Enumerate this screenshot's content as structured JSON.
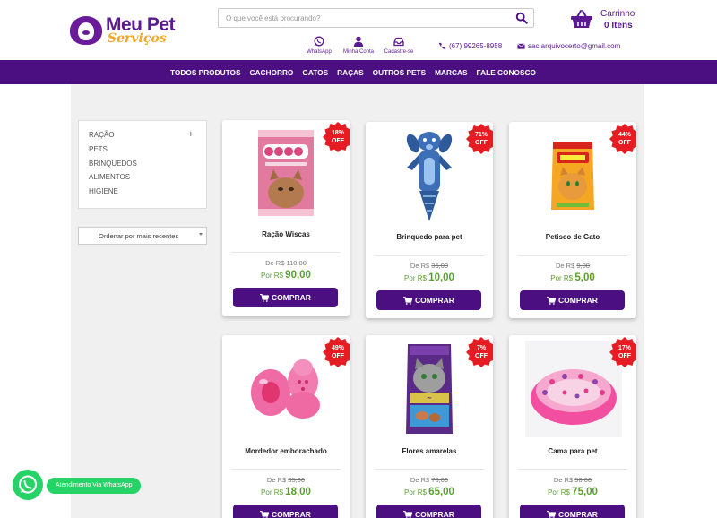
{
  "brand": {
    "name": "Meu Pet",
    "tagline": "Serviços"
  },
  "search": {
    "placeholder": "O que você está procurando?"
  },
  "cart": {
    "label": "Carrinho",
    "count": "0 Itens"
  },
  "quick_links": [
    {
      "label": "WhatsApp",
      "icon": "whatsapp-icon"
    },
    {
      "label": "Minha Conta",
      "icon": "user-icon"
    },
    {
      "label": "Cadastre-se",
      "icon": "signup-icon"
    }
  ],
  "contact": {
    "phone": "(67) 99265-8958",
    "email": "sac.arquivocerto@gmail.com"
  },
  "nav": [
    "TODOS PRODUTOS",
    "CACHORRO",
    "GATOS",
    "RAÇAS",
    "OUTROS PETS",
    "MARCAS",
    "FALE CONOSCO"
  ],
  "filters": {
    "items": [
      "RAÇÃO",
      "PETS",
      "BRINQUEDOS",
      "ALIMENTOS",
      "HIGIENE"
    ],
    "expand_symbol": "+"
  },
  "sort": {
    "selected": "Ordenar por mais recentes"
  },
  "products": [
    {
      "name": "Ração Wiscas",
      "badge_pct": "18%",
      "badge_off": "OFF",
      "old_prefix": "De R$",
      "old_price": "110,00",
      "new_prefix": "Por R$",
      "new_price": "90,00",
      "button": "COMPRAR"
    },
    {
      "name": "Brinquedo para pet",
      "badge_pct": "71%",
      "badge_off": "OFF",
      "old_prefix": "De R$",
      "old_price": "35,00",
      "new_prefix": "Por R$",
      "new_price": "10,00",
      "button": "COMPRAR"
    },
    {
      "name": "Petisco de Gato",
      "badge_pct": "44%",
      "badge_off": "OFF",
      "old_prefix": "De R$",
      "old_price": "9,00",
      "new_prefix": "Por R$",
      "new_price": "5,00",
      "button": "COMPRAR"
    },
    {
      "name": "Mordedor emborachado",
      "badge_pct": "49%",
      "badge_off": "OFF",
      "old_prefix": "De R$",
      "old_price": "35,00",
      "new_prefix": "Por R$",
      "new_price": "18,00",
      "button": "COMPRAR"
    },
    {
      "name": "Flores amarelas",
      "badge_pct": "7%",
      "badge_off": "OFF",
      "old_prefix": "De R$",
      "old_price": "70,00",
      "new_prefix": "Por R$",
      "new_price": "65,00",
      "button": "COMPRAR"
    },
    {
      "name": "Cama para pet",
      "badge_pct": "17%",
      "badge_off": "OFF",
      "old_prefix": "De R$",
      "old_price": "90,00",
      "new_prefix": "Por R$",
      "new_price": "75,00",
      "button": "COMPRAR"
    }
  ],
  "whatsapp": {
    "label": "Atendimento Via WhatsApp"
  },
  "colors": {
    "primary": "#4b0f82",
    "accent": "#f4a623",
    "badge": "#e51c23",
    "price": "#5aa12b",
    "whatsapp": "#25d366"
  }
}
